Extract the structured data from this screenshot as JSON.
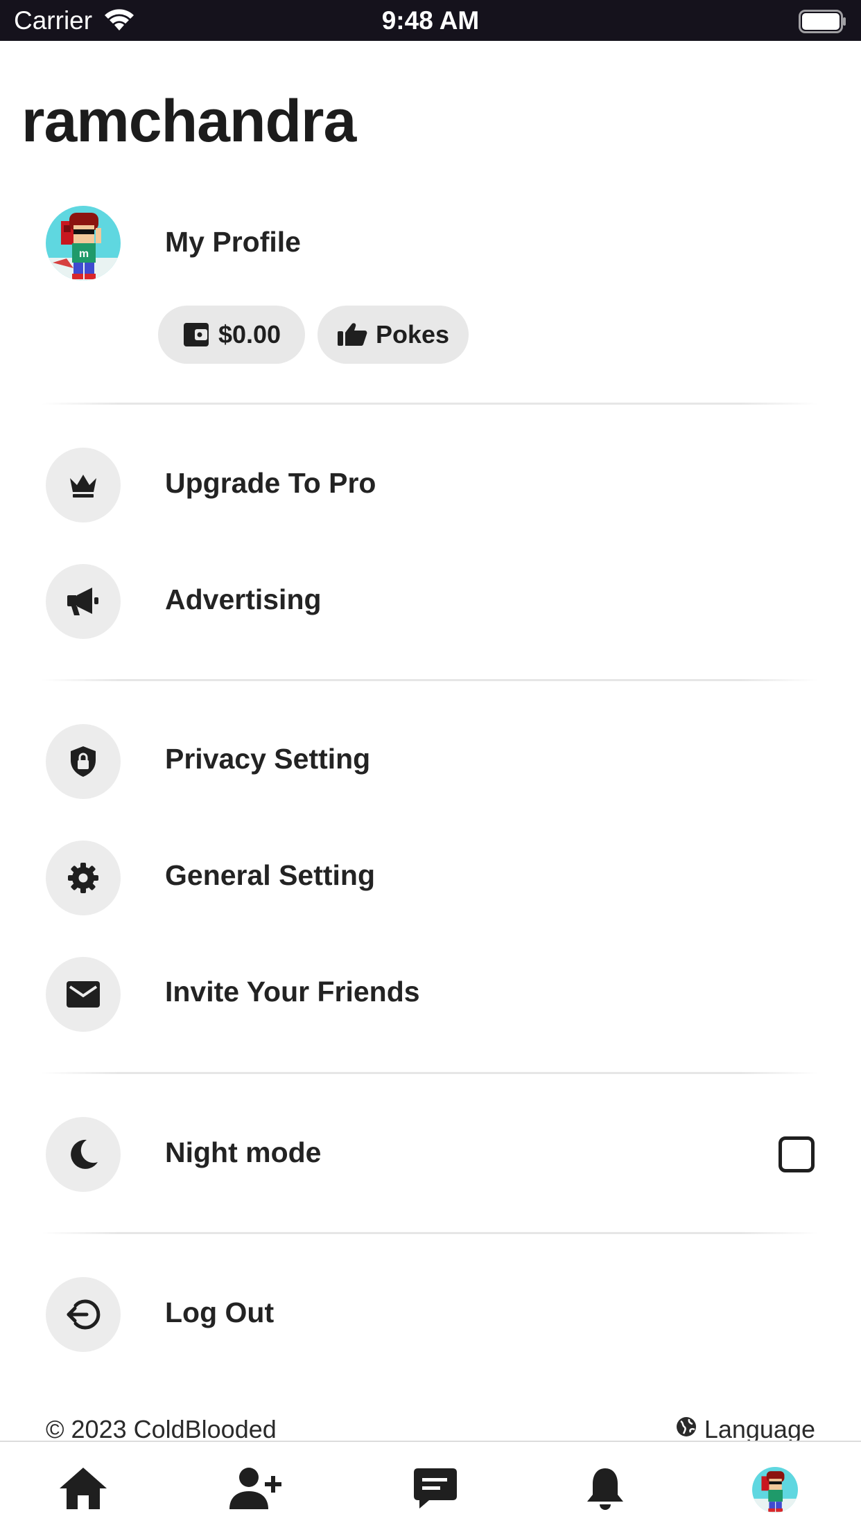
{
  "status_bar": {
    "carrier": "Carrier",
    "time": "9:48 AM"
  },
  "page": {
    "title": "ramchandra"
  },
  "profile": {
    "label": "My Profile",
    "wallet_label": "$0.00",
    "pokes_label": "Pokes"
  },
  "menu": {
    "upgrade": "Upgrade To Pro",
    "advertising": "Advertising",
    "privacy": "Privacy Setting",
    "general": "General Setting",
    "invite": "Invite Your Friends",
    "night_mode": "Night mode",
    "night_mode_checked": false,
    "logout": "Log Out"
  },
  "footer": {
    "copyright": "© 2023 ColdBlooded",
    "language": "Language"
  },
  "bottom_nav": [
    "home-icon",
    "add-friend-icon",
    "messages-icon",
    "notifications-icon",
    "profile-avatar"
  ],
  "colors": {
    "status_bar_bg": "#15121c",
    "icon_circle_bg": "#ececec",
    "pill_bg": "#e8e8e8",
    "text": "#1f1f1f"
  }
}
